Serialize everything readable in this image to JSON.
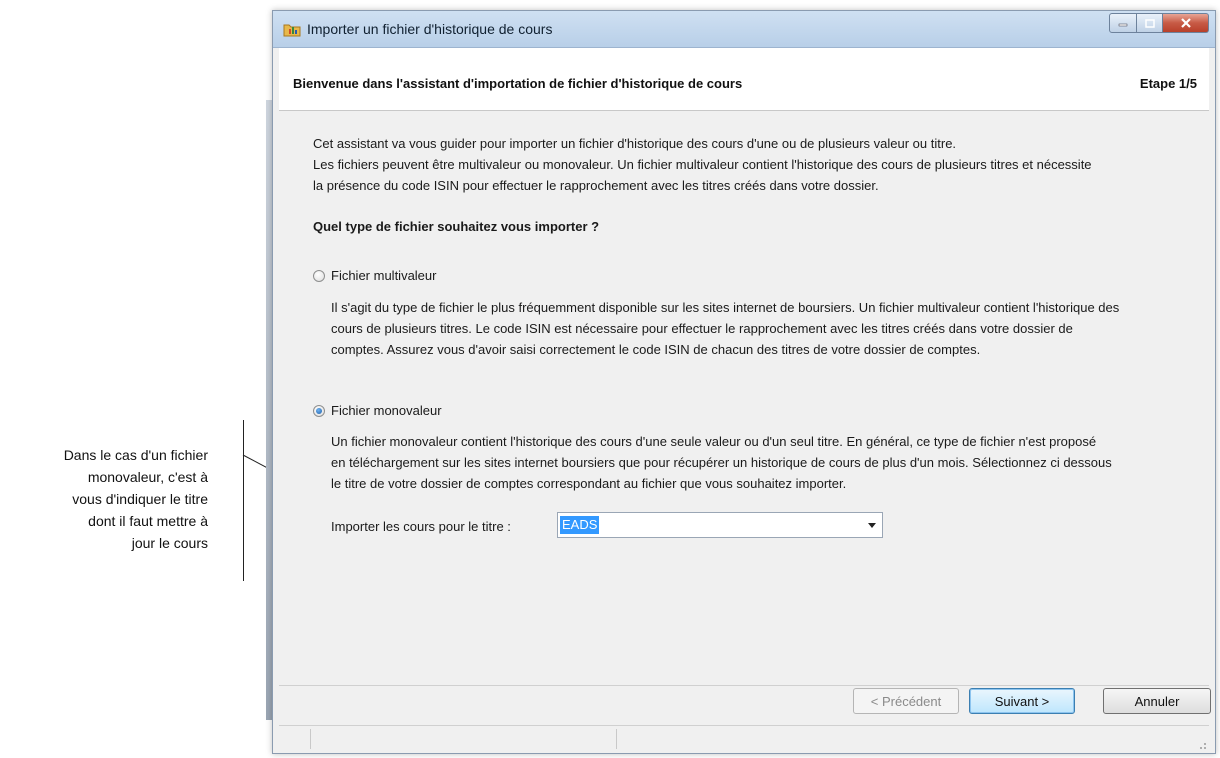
{
  "annotation": {
    "lines": [
      "Dans le cas d'un fichier",
      "monovaleur, c'est à",
      "vous d'indiquer le titre",
      "dont il faut mettre à",
      "jour le cours"
    ]
  },
  "window": {
    "title": "Importer un fichier d'historique de cours",
    "icon": "chart-folder-icon"
  },
  "header": {
    "title": "Bienvenue dans l'assistant d'importation de fichier d'historique de cours",
    "step": "Etape 1/5"
  },
  "intro": {
    "lines": [
      "Cet assistant va vous guider pour importer un fichier d'historique des cours d'une ou de plusieurs valeur ou titre.",
      "Les fichiers peuvent être multivaleur ou monovaleur. Un fichier multivaleur contient l'historique des cours de plusieurs titres et nécessite",
      "la présence du code ISIN pour effectuer le rapprochement avec les titres créés dans votre dossier."
    ]
  },
  "question": "Quel type de fichier souhaitez vous importer ?",
  "options": [
    {
      "label": "Fichier multivaleur",
      "checked": false,
      "description": [
        "Il s'agit du type de fichier le plus fréquemment disponible sur les sites internet de boursiers. Un fichier multivaleur contient l'historique des",
        "cours de plusieurs titres. Le code ISIN est nécessaire pour effectuer le rapprochement avec les titres créés dans votre dossier de",
        "comptes. Assurez vous d'avoir saisi correctement le code ISIN de chacun des titres de votre dossier de comptes."
      ]
    },
    {
      "label": "Fichier monovaleur",
      "checked": true,
      "description": [
        "Un fichier monovaleur contient l'historique des cours d'une seule valeur ou d'un seul titre. En général, ce type de fichier n'est proposé",
        "en téléchargement sur les sites internet boursiers que pour récupérer un historique de cours de plus d'un mois. Sélectionnez ci dessous",
        "le titre de votre dossier de comptes correspondant au fichier que vous souhaitez importer."
      ]
    }
  ],
  "field": {
    "label": "Importer les cours pour le titre :",
    "value": "EADS"
  },
  "buttons": {
    "previous": "< Précédent",
    "next": "Suivant >",
    "cancel": "Annuler"
  },
  "colors": {
    "selection": "#3399ff",
    "close_button": "#c75a45"
  }
}
